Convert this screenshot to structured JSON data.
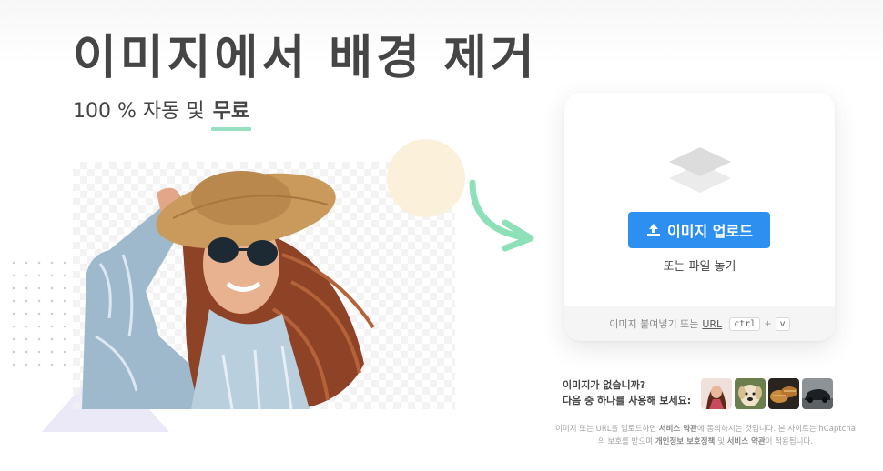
{
  "hero": {
    "title": "이미지에서 배경 제거",
    "subtitle_prefix": "100 % 자동 및",
    "subtitle_highlight": "무료"
  },
  "upload": {
    "button_label": "이미지 업로드",
    "drop_text": "또는 파일 놓기",
    "paste_text": "이미지 붙여넣기 또는",
    "url_label": "URL",
    "key_ctrl": "ctrl",
    "key_plus": "+",
    "key_v": "v"
  },
  "samples": {
    "line1": "이미지가 없습니까?",
    "line2": "다음 중 하나를 사용해 보세요:",
    "items": [
      "sample-woman",
      "sample-dog",
      "sample-bread",
      "sample-car"
    ]
  },
  "terms": {
    "part1": "이미지 또는 URL을 업로드하면",
    "tos1": "서비스 약관",
    "part2": "에 동의하시는 것입니다. 본 사이트는 hCaptcha의 보호를 받으며",
    "privacy": "개인정보 보호정책",
    "part3": "및",
    "tos2": "서비스 약관",
    "part4": "이 적용됩니다."
  },
  "colors": {
    "accent": "#2d8ff0",
    "highlight": "#96e0c0",
    "arrow": "#8ee0b9",
    "text": "#454545"
  }
}
